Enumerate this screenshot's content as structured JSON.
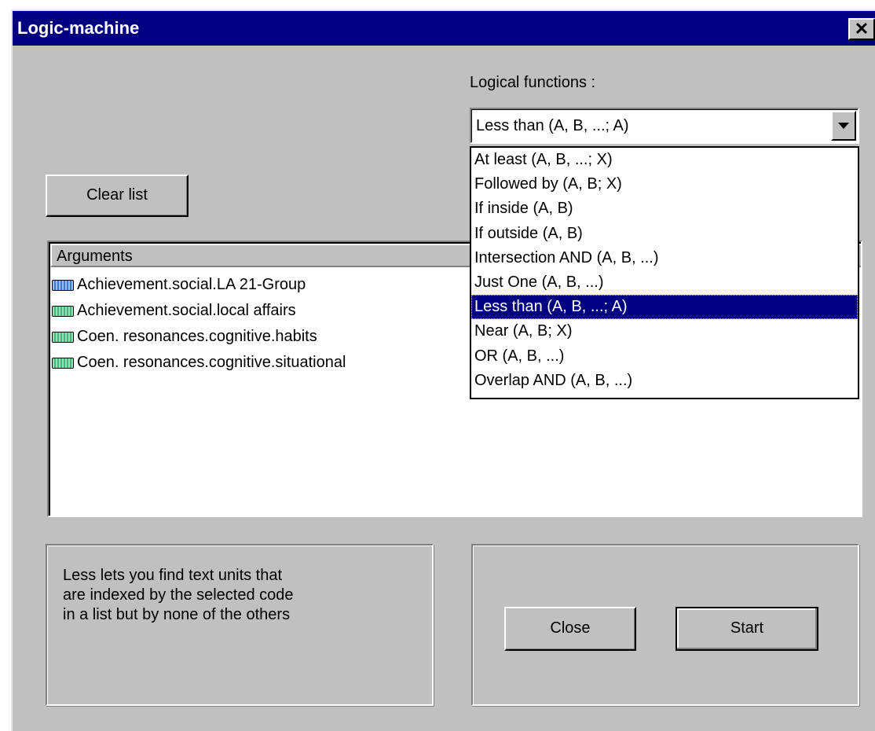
{
  "window": {
    "title": "Logic-machine",
    "close_glyph": "✕"
  },
  "logical_functions": {
    "label": "Logical functions :",
    "selected": "Less than (A, B, ...; A)",
    "options": [
      "At least (A, B, ...; X)",
      "Followed by (A, B; X)",
      "If inside (A, B)",
      "If outside (A, B)",
      "Intersection AND (A, B, ...)",
      "Just One (A, B, ...)",
      "Less than (A, B, ...; A)",
      "Near (A, B; X)",
      "OR (A, B, ...)",
      "Overlap AND (A, B, ...)"
    ],
    "highlighted_index": 6
  },
  "buttons": {
    "clear_list": "Clear list",
    "close": "Close",
    "start": "Start"
  },
  "arguments": {
    "header": "Arguments",
    "items": [
      {
        "label": "Achievement.social.LA 21-Group",
        "icon": "blue-code-icon",
        "color": "#3a7bd5"
      },
      {
        "label": "Achievement.social.local affairs",
        "icon": "green-code-icon",
        "color": "#3cb878"
      },
      {
        "label": "Coen. resonances.cognitive.habits",
        "icon": "green-code-icon",
        "color": "#3cb878"
      },
      {
        "label": "Coen. resonances.cognitive.situational",
        "icon": "green-code-icon",
        "color": "#3cb878"
      }
    ]
  },
  "description": {
    "line1": "Less lets you find text units that",
    "line2": "are indexed by the selected code",
    "line3": "in a list but by none of the others"
  }
}
